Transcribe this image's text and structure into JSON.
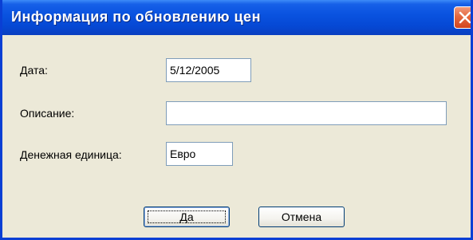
{
  "window": {
    "title": "Информация по обновлению цен"
  },
  "form": {
    "date_label": "Дата:",
    "date_value": "5/12/2005",
    "description_label": "Описание:",
    "description_value": "",
    "currency_label": "Денежная единица:",
    "currency_value": "Евро"
  },
  "buttons": {
    "ok_label": "Да",
    "cancel_label": "Отмена"
  },
  "icons": {
    "close": "close-icon"
  },
  "colors": {
    "titlebar": "#0a53e0",
    "close_button": "#e4683f",
    "dialog_background": "#ece9d8"
  }
}
